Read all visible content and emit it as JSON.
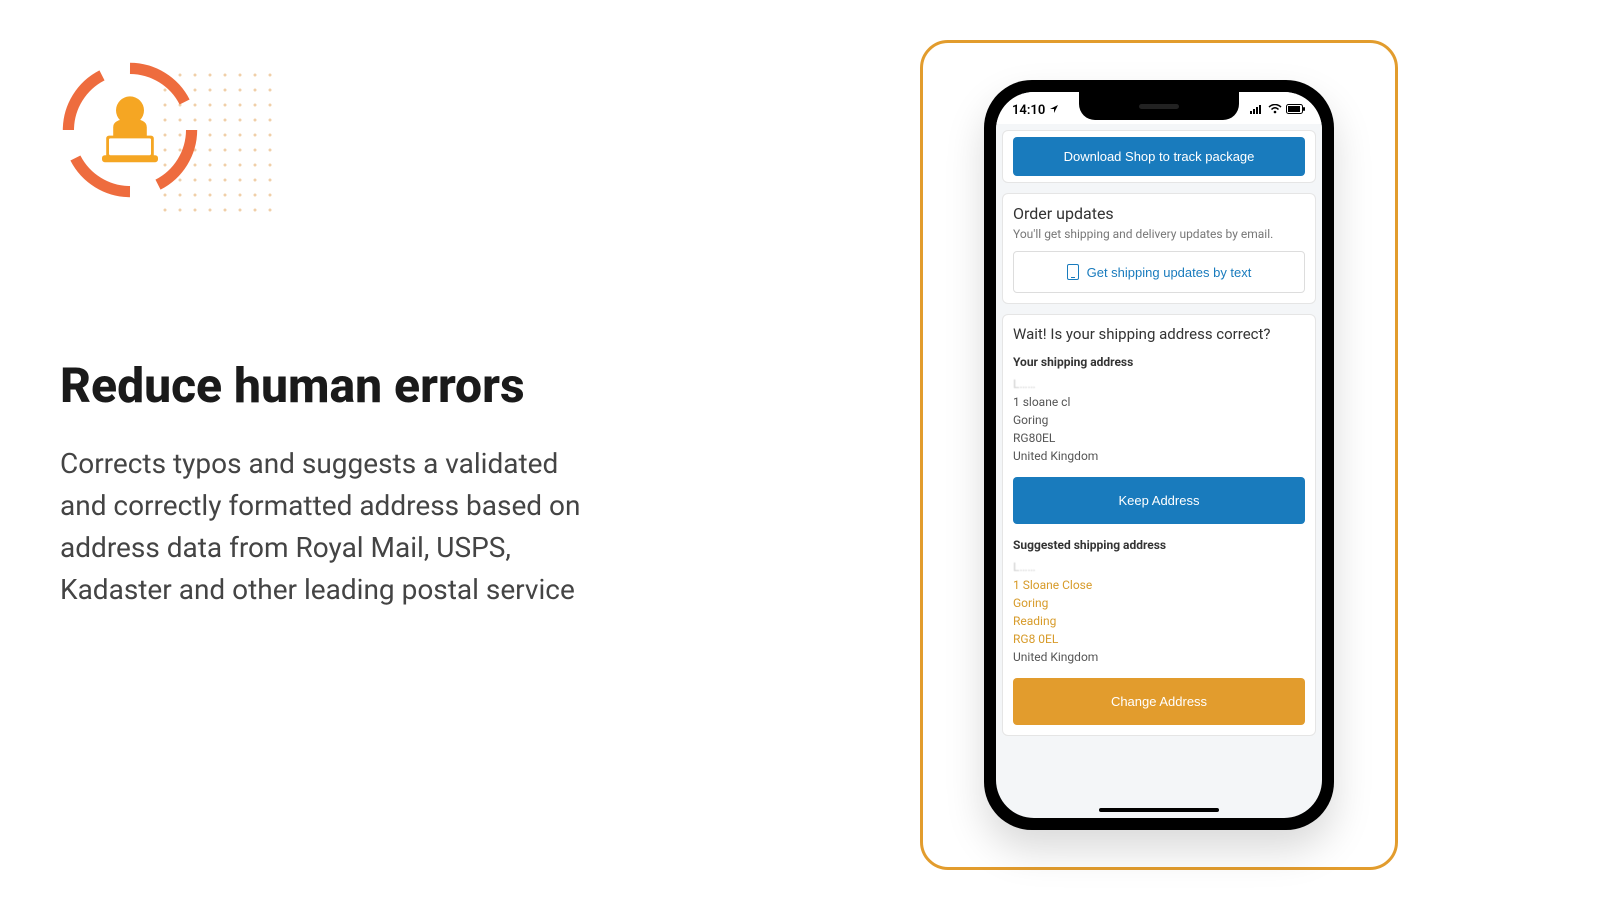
{
  "left": {
    "heading": "Reduce human errors",
    "body": "Corrects typos and suggests a validated and correctly formatted address based on address data from Royal Mail, USPS, Kadaster and other leading postal service"
  },
  "phone": {
    "status_time": "14:10",
    "download_btn": "Download Shop to track package",
    "order_updates": {
      "title": "Order updates",
      "subtitle": "You'll get shipping and delivery updates by email.",
      "text_btn": "Get shipping updates by text"
    },
    "address_check": {
      "title": "Wait! Is your shipping address correct?",
      "your_label": "Your shipping address",
      "your_name_obscured": "L……",
      "your_lines": {
        "l1": "1 sloane cl",
        "l2": "Goring",
        "l3": "RG80EL",
        "l4": "United Kingdom"
      },
      "keep_btn": "Keep Address",
      "suggested_label": "Suggested shipping address",
      "suggested_name_obscured": "L……",
      "suggested_lines": {
        "l1": "1 Sloane Close",
        "l2": "Goring",
        "l3": "Reading",
        "l4": "RG8 0EL",
        "l5": "United Kingdom"
      },
      "change_btn": "Change Address"
    }
  }
}
